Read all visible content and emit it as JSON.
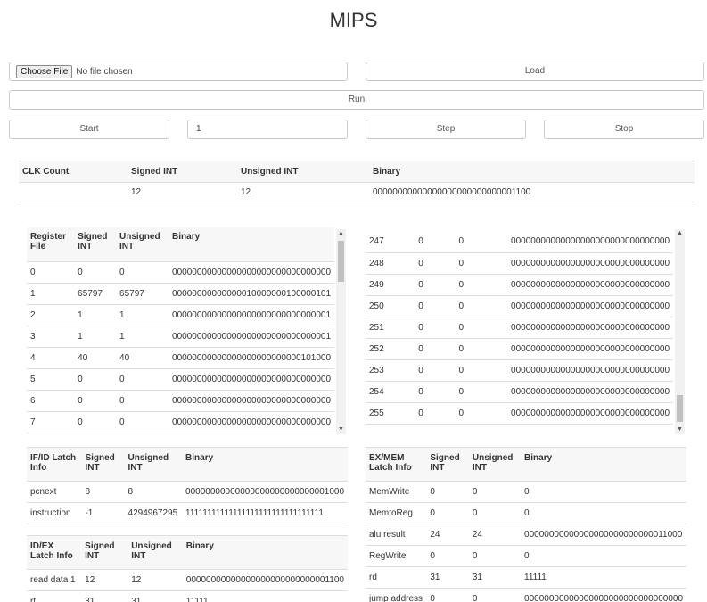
{
  "page_title": "MIPS",
  "controls": {
    "choose_file_label": "Choose File",
    "file_status": "No file chosen",
    "load_label": "Load",
    "run_label": "Run",
    "start_label": "Start",
    "step_value": "1",
    "step_label": "Step",
    "stop_label": "Stop"
  },
  "clk_table": {
    "headers": [
      "CLK Count",
      "Signed INT",
      "Unsigned INT",
      "Binary"
    ],
    "row": [
      "",
      "12",
      "12",
      "00000000000000000000000000001100"
    ]
  },
  "register_file": {
    "headers": [
      "Register File",
      "Signed INT",
      "Unsigned INT",
      "Binary"
    ],
    "rows": [
      [
        "0",
        "0",
        "0",
        "00000000000000000000000000000000"
      ],
      [
        "1",
        "65797",
        "65797",
        "00000000000000010000000100000101"
      ],
      [
        "2",
        "1",
        "1",
        "00000000000000000000000000000001"
      ],
      [
        "3",
        "1",
        "1",
        "00000000000000000000000000000001"
      ],
      [
        "4",
        "40",
        "40",
        "00000000000000000000000000101000"
      ],
      [
        "5",
        "0",
        "0",
        "00000000000000000000000000000000"
      ],
      [
        "6",
        "0",
        "0",
        "00000000000000000000000000000000"
      ],
      [
        "7",
        "0",
        "0",
        "00000000000000000000000000000000"
      ]
    ]
  },
  "memory": {
    "rows": [
      [
        "247",
        "0",
        "0",
        "00000000000000000000000000000000"
      ],
      [
        "248",
        "0",
        "0",
        "00000000000000000000000000000000"
      ],
      [
        "249",
        "0",
        "0",
        "00000000000000000000000000000000"
      ],
      [
        "250",
        "0",
        "0",
        "00000000000000000000000000000000"
      ],
      [
        "251",
        "0",
        "0",
        "00000000000000000000000000000000"
      ],
      [
        "252",
        "0",
        "0",
        "00000000000000000000000000000000"
      ],
      [
        "253",
        "0",
        "0",
        "00000000000000000000000000000000"
      ],
      [
        "254",
        "0",
        "0",
        "00000000000000000000000000000000"
      ],
      [
        "255",
        "0",
        "0",
        "00000000000000000000000000000000"
      ]
    ]
  },
  "if_id": {
    "headers": [
      "IF/ID Latch Info",
      "Signed INT",
      "Unsigned INT",
      "Binary"
    ],
    "rows": [
      [
        "pcnext",
        "8",
        "8",
        "00000000000000000000000000001000"
      ],
      [
        "instruction",
        "-1",
        "4294967295",
        "11111111111111111111111111111111"
      ]
    ]
  },
  "id_ex": {
    "headers": [
      "ID/EX Latch Info",
      "Signed INT",
      "Unsigned INT",
      "Binary"
    ],
    "rows": [
      [
        "read data 1",
        "12",
        "12",
        "00000000000000000000000000001100"
      ],
      [
        "rt",
        "31",
        "31",
        "11111"
      ]
    ]
  },
  "ex_mem": {
    "headers": [
      "EX/MEM Latch Info",
      "Signed INT",
      "Unsigned INT",
      "Binary"
    ],
    "rows": [
      [
        "MemWrite",
        "0",
        "0",
        "0"
      ],
      [
        "MemtoReg",
        "0",
        "0",
        "0"
      ],
      [
        "alu result",
        "24",
        "24",
        "00000000000000000000000000011000"
      ],
      [
        "RegWrite",
        "0",
        "0",
        "0"
      ],
      [
        "rd",
        "31",
        "31",
        "11111"
      ],
      [
        "jump address",
        "0",
        "0",
        "00000000000000000000000000000000"
      ]
    ]
  }
}
